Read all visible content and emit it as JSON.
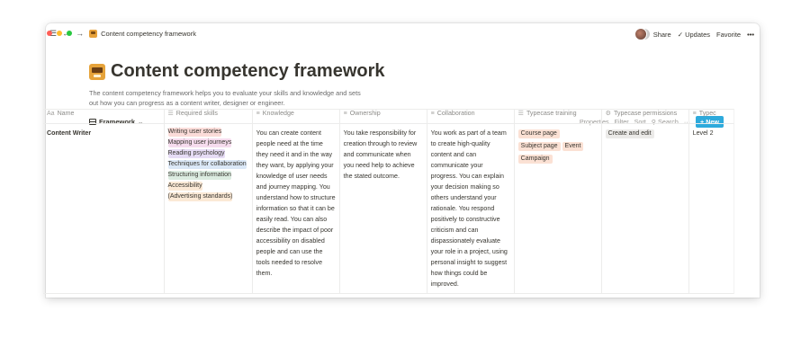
{
  "topbar": {
    "breadcrumb": "Content competency framework",
    "share": "Share",
    "updates": "Updates",
    "favorite": "Favorite",
    "more": "•••"
  },
  "page": {
    "title": "Content competency framework",
    "description": "The content competency framework helps you to evaluate your skills and knowledge and sets out how you can progress as a content writer, designer or engineer."
  },
  "view": {
    "name": "Framework",
    "properties": "Properties",
    "filter": "Filter",
    "sort": "Sort",
    "search": "Search",
    "more": "···",
    "new": "New"
  },
  "table": {
    "headers": [
      "Name",
      "Required skills",
      "Knowledge",
      "Ownership",
      "Collaboration",
      "Typecase training",
      "Typecase permissions",
      "Typec"
    ],
    "row": {
      "name": "Content Writer",
      "required_skills": [
        {
          "label": "Writing user stories",
          "color": "#fbdcd9"
        },
        {
          "label": "Mapping user journeys",
          "color": "#f6dcee"
        },
        {
          "label": "Reading psychology",
          "color": "#e6dcf5"
        },
        {
          "label": "Techniques for collaboration",
          "color": "#dbe8f7"
        },
        {
          "label": "Structuring information",
          "color": "#dcece1"
        },
        {
          "label": "Accessibility",
          "color": "#fbe9d6"
        },
        {
          "label": "(Advertising standards)",
          "color": "#fbe9d6"
        }
      ],
      "knowledge": "You can create content people need at the time they need it and in the way they want, by applying your knowledge of user needs and journey mapping. You understand how to structure information so that it can be easily read. You can also describe the impact of poor accessibility on disabled people and can use the tools needed to resolve them.",
      "ownership": "You take responsibility for creation through to review and communicate when you need help to achieve the stated outcome.",
      "collaboration": "You work as part of a team to create high-quality content and can communicate your progress. You can explain your decision making so others understand your rationale. You respond positively to constructive criticism and can dispassionately evaluate your role in a project, using personal insight to suggest how things could be improved.",
      "typecase_training": [
        {
          "label": "Course page",
          "color": "#fbe1d4"
        },
        {
          "label": "Subject page",
          "color": "#fbe1d4"
        },
        {
          "label": "Event",
          "color": "#fbe1d4"
        },
        {
          "label": "Campaign",
          "color": "#fbe1d4"
        }
      ],
      "typecase_permissions": [
        {
          "label": "Create and edit",
          "color": "#ebeae8"
        }
      ],
      "typec": "Level 2"
    }
  }
}
